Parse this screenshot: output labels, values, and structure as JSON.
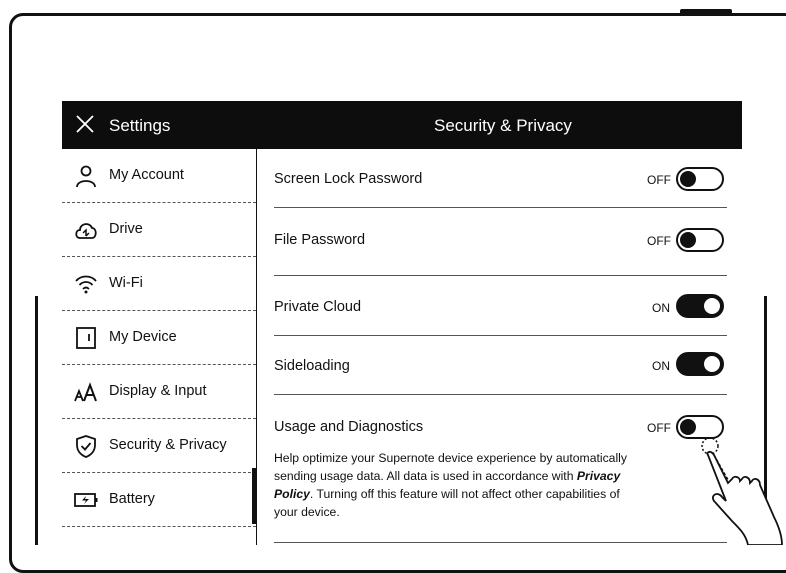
{
  "header": {
    "close_icon": "close-icon",
    "settings_title": "Settings",
    "page_title": "Security & Privacy"
  },
  "sidebar": {
    "items": [
      {
        "label": "My Account",
        "icon": "person-icon"
      },
      {
        "label": "Drive",
        "icon": "cloud-sync-icon"
      },
      {
        "label": "Wi-Fi",
        "icon": "wifi-icon"
      },
      {
        "label": "My Device",
        "icon": "device-icon"
      },
      {
        "label": "Display & Input",
        "icon": "text-size-icon"
      },
      {
        "label": "Security & Privacy",
        "icon": "shield-icon",
        "active": true
      },
      {
        "label": "Battery",
        "icon": "battery-icon"
      }
    ]
  },
  "settings": [
    {
      "label": "Screen Lock Password",
      "state": "OFF"
    },
    {
      "label": "File Password",
      "state": "OFF"
    },
    {
      "label": "Private Cloud",
      "state": "ON"
    },
    {
      "label": "Sideloading",
      "state": "ON"
    },
    {
      "label": "Usage and Diagnostics",
      "state": "OFF"
    }
  ],
  "usage_description": {
    "part1": "Help optimize your Supernote device experience by automatically sending usage data. All data is used in accordance with ",
    "link": "Privacy Policy",
    "part2": ". Turning off this feature will not affect other capabilities of your device."
  },
  "colors": {
    "bar": "#0d0d0d",
    "background": "#ffffff",
    "ink": "#111111"
  }
}
